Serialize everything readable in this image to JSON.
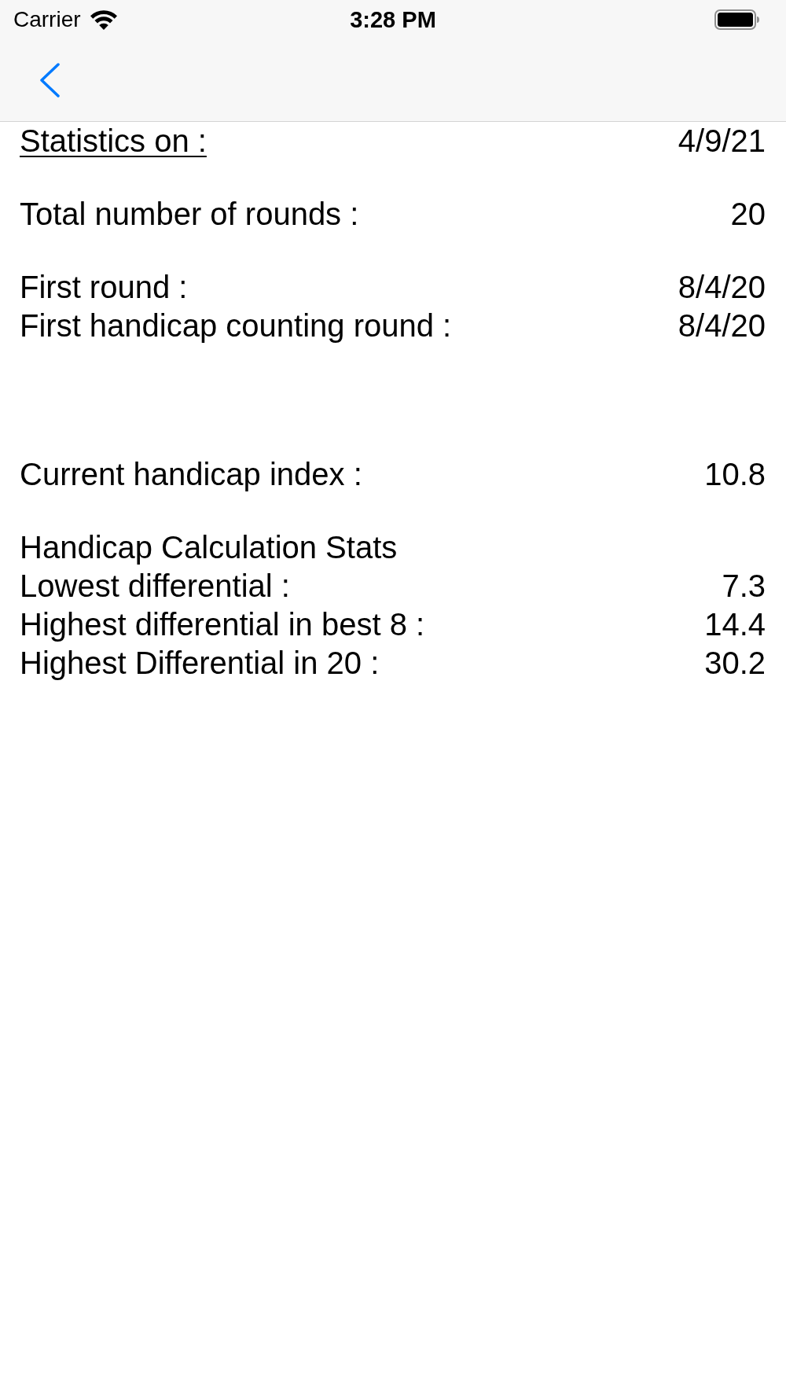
{
  "status_bar": {
    "carrier": "Carrier",
    "time": "3:28 PM"
  },
  "report": {
    "title": "Statistics on :",
    "date": "4/9/21"
  },
  "rounds": {
    "label": "Total number of rounds :",
    "value": "20"
  },
  "dates": [
    {
      "label": "First round :",
      "value": "8/4/20"
    },
    {
      "label": "First handicap counting round :",
      "value": "8/4/20"
    }
  ],
  "handicap": {
    "label": "Current handicap index :",
    "value": "10.8"
  },
  "calculation": {
    "title": "Handicap Calculation Stats",
    "rows": [
      {
        "label": "Lowest differential :",
        "value": "7.3"
      },
      {
        "label": "Highest differential in best 8 :",
        "value": "14.4"
      },
      {
        "label": "Highest Differential in 20 :",
        "value": "30.2"
      }
    ]
  }
}
